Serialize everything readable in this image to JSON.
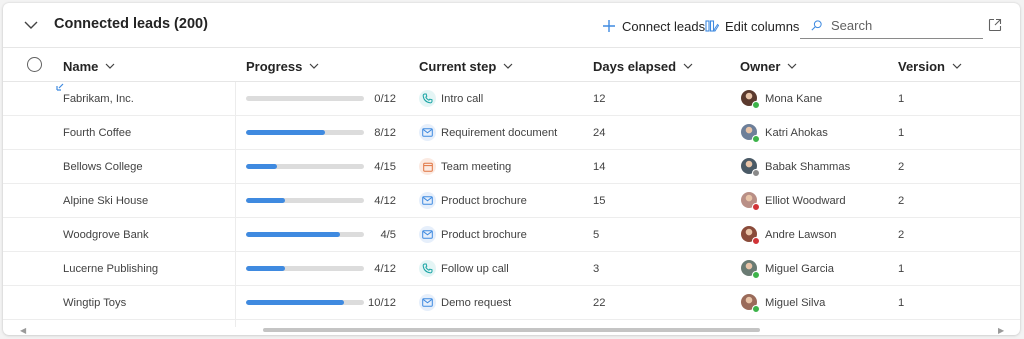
{
  "header": {
    "title": "Connected leads (200)",
    "connect_label": "Connect leads",
    "edit_columns_label": "Edit columns",
    "search_placeholder": "Search"
  },
  "columns": {
    "name": "Name",
    "progress": "Progress",
    "current_step": "Current step",
    "days_elapsed": "Days elapsed",
    "owner": "Owner",
    "version": "Version"
  },
  "colors": {
    "accent": "#3f8ae0",
    "bar_track": "#dcdcdc",
    "call_icon": "#1aa5a5",
    "doc_icon": "#3f8ae0",
    "meeting_icon": "#e0733f",
    "presence_available": "#3db34a",
    "presence_busy": "#d13438",
    "presence_offline": "#8a8a8a"
  },
  "rows": [
    {
      "name": "Fabrikam, Inc.",
      "progress_done": 0,
      "progress_total": 12,
      "progress_text": "0/12",
      "step_icon": "phone-icon",
      "step": "Intro call",
      "days": "12",
      "owner": "Mona Kane",
      "presence": "available",
      "version": "1",
      "avatar_color": "#5b3a2e"
    },
    {
      "name": "Fourth Coffee",
      "progress_done": 8,
      "progress_total": 12,
      "progress_text": "8/12",
      "step_icon": "mail-icon",
      "step": "Requirement document",
      "days": "24",
      "owner": "Katri Ahokas",
      "presence": "available",
      "version": "1",
      "avatar_color": "#6d7f99"
    },
    {
      "name": "Bellows College",
      "progress_done": 4,
      "progress_total": 15,
      "progress_text": "4/15",
      "step_icon": "calendar-icon",
      "step": "Team meeting",
      "days": "14",
      "owner": "Babak Shammas",
      "presence": "offline",
      "version": "2",
      "avatar_color": "#4a5a66"
    },
    {
      "name": "Alpine Ski House",
      "progress_done": 4,
      "progress_total": 12,
      "progress_text": "4/12",
      "step_icon": "mail-icon",
      "step": "Product brochure",
      "days": "15",
      "owner": "Elliot Woodward",
      "presence": "busy",
      "version": "2",
      "avatar_color": "#b98f86"
    },
    {
      "name": "Woodgrove Bank",
      "progress_done": 4,
      "progress_total": 5,
      "progress_text": "4/5",
      "step_icon": "mail-icon",
      "step": "Product brochure",
      "days": "5",
      "owner": "Andre Lawson",
      "presence": "busy",
      "version": "2",
      "avatar_color": "#8a4b3a"
    },
    {
      "name": "Lucerne Publishing",
      "progress_done": 4,
      "progress_total": 12,
      "progress_text": "4/12",
      "step_icon": "phone-icon",
      "step": "Follow up call",
      "days": "3",
      "owner": "Miguel Garcia",
      "presence": "available",
      "version": "1",
      "avatar_color": "#6a7b73"
    },
    {
      "name": "Wingtip Toys",
      "progress_done": 10,
      "progress_total": 12,
      "progress_text": "10/12",
      "step_icon": "mail-icon",
      "step": "Demo request",
      "days": "22",
      "owner": "Miguel Silva",
      "presence": "available",
      "version": "1",
      "avatar_color": "#9a6b5a"
    }
  ]
}
